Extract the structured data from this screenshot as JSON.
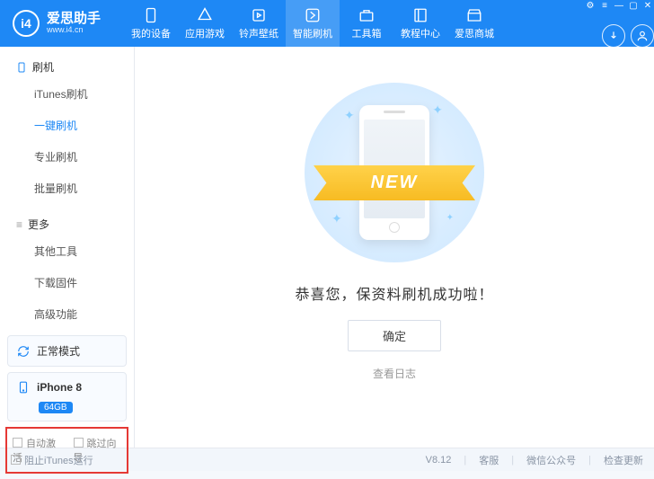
{
  "header": {
    "logo_badge": "i4",
    "logo_title": "爱思助手",
    "logo_sub": "www.i4.cn",
    "nav": [
      {
        "label": "我的设备",
        "icon": "phone"
      },
      {
        "label": "应用游戏",
        "icon": "apps"
      },
      {
        "label": "铃声壁纸",
        "icon": "music"
      },
      {
        "label": "智能刷机",
        "icon": "flash",
        "active": true
      },
      {
        "label": "工具箱",
        "icon": "toolbox"
      },
      {
        "label": "教程中心",
        "icon": "book"
      },
      {
        "label": "爱思商城",
        "icon": "store"
      }
    ]
  },
  "sidebar": {
    "group1_title": "刷机",
    "group1": [
      {
        "label": "iTunes刷机"
      },
      {
        "label": "一键刷机",
        "active": true
      },
      {
        "label": "专业刷机"
      },
      {
        "label": "批量刷机"
      }
    ],
    "group2_title": "更多",
    "group2": [
      {
        "label": "其他工具"
      },
      {
        "label": "下载固件"
      },
      {
        "label": "高级功能"
      }
    ],
    "mode_label": "正常模式",
    "device_name": "iPhone 8",
    "device_badge": "64GB",
    "auto_activate": "自动激活",
    "skip_wizard": "跳过向导"
  },
  "main": {
    "ribbon": "NEW",
    "success": "恭喜您，保资料刷机成功啦！",
    "confirm": "确定",
    "view_log": "查看日志"
  },
  "footer": {
    "block_itunes": "阻止iTunes运行",
    "version": "V8.12",
    "support": "客服",
    "wechat": "微信公众号",
    "check_update": "检查更新"
  }
}
